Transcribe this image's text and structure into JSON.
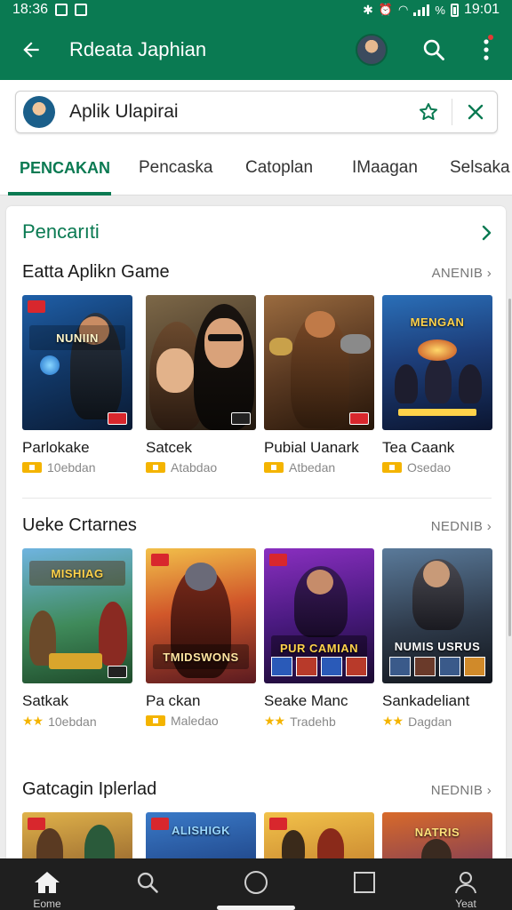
{
  "status_bar": {
    "time_left": "18:36",
    "time_right": "19:01"
  },
  "app_bar": {
    "title": "Rdeata Japhian",
    "back_icon": "arrow-left-icon",
    "search_icon": "search-icon",
    "more_icon": "more-vert-icon"
  },
  "search": {
    "query": "Aplik Ulapirai",
    "star_icon": "star-outline-icon",
    "clear_icon": "close-icon"
  },
  "tabs": [
    {
      "label": "PENCAKAN",
      "active": true
    },
    {
      "label": "Pencaska",
      "active": false
    },
    {
      "label": "Catoplan",
      "active": false
    },
    {
      "label": "IMaagan",
      "active": false
    },
    {
      "label": "Selsaka",
      "active": false
    }
  ],
  "main": {
    "heading": "Pencarıti"
  },
  "sections": [
    {
      "title": "Eatta Aplikn Game",
      "more": "ANENIB ›",
      "cards": [
        {
          "name": "Parlokake",
          "meta": "10ebdan",
          "rating_type": "pill",
          "logo": "NUNIIN"
        },
        {
          "name": "Satcek",
          "meta": "Atabdao",
          "rating_type": "pill",
          "logo": ""
        },
        {
          "name": "Pubial Uanark",
          "meta": "Atbedan",
          "rating_type": "pill",
          "logo": ""
        },
        {
          "name": "Tea Caank",
          "meta": "Osedao",
          "rating_type": "pill",
          "logo": "MENGAN"
        }
      ]
    },
    {
      "title": "Ueke Crtarnes",
      "more": "NEDNIB ›",
      "cards": [
        {
          "name": "Satkak",
          "meta": "10ebdan",
          "rating_type": "stars",
          "logo": "MISHIAG"
        },
        {
          "name": "Pa ckan",
          "meta": "Maledao",
          "rating_type": "pill",
          "logo": "TMIDSWONS"
        },
        {
          "name": "Seake Manc",
          "meta": "Tradehb",
          "rating_type": "stars",
          "logo": "PUR CAMIAN"
        },
        {
          "name": "Sankadeliant",
          "meta": "Dagdan",
          "rating_type": "stars",
          "logo": "NUMIS USRUS"
        }
      ]
    },
    {
      "title": "Gatcagin Iplerlad",
      "more": "NEDNIB ›",
      "cards": [
        {
          "logo": ""
        },
        {
          "logo": "ALISHIGK"
        },
        {
          "logo": ""
        },
        {
          "logo": "NATRIS"
        }
      ]
    }
  ],
  "bottom_nav": [
    {
      "label": "Eome",
      "icon": "home-icon",
      "active": true
    },
    {
      "label": "",
      "icon": "search-icon",
      "active": false
    },
    {
      "label": "",
      "icon": "circle-icon",
      "active": false
    },
    {
      "label": "",
      "icon": "square-icon",
      "active": false
    },
    {
      "label": "Yeat",
      "icon": "profile-icon",
      "active": false
    }
  ],
  "colors": {
    "primary": "#0a7a52",
    "accent": "#f4b400",
    "badge": "#d8272d"
  }
}
